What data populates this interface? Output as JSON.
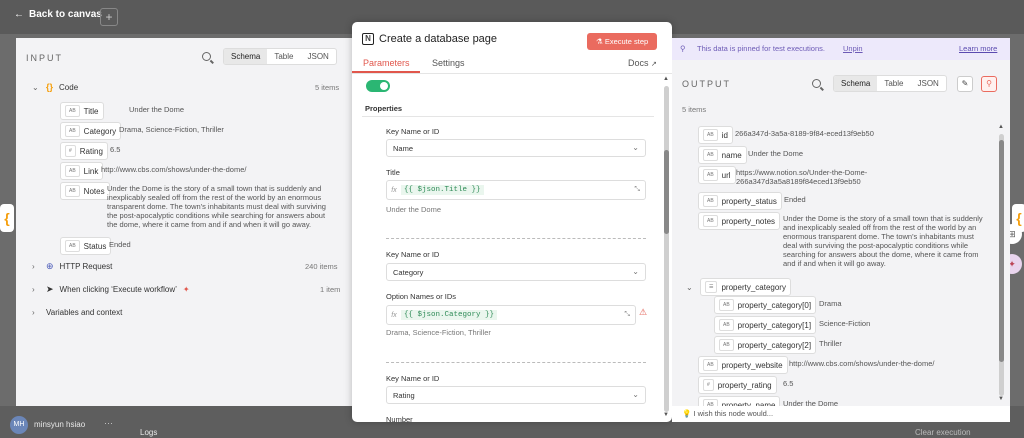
{
  "canvas": {
    "back_label": "Back to canvas",
    "user_initials": "MH",
    "user_name": "minsyun hsiao",
    "logs_label": "Logs",
    "clear_execution": "Clear execution",
    "more_icon": "dots-icon",
    "add_icon": "plus-icon"
  },
  "input": {
    "title": "INPUT",
    "view_tabs": [
      "Schema",
      "Table",
      "JSON"
    ],
    "active_view": "Schema",
    "code_node": {
      "label": "Code",
      "count": "5 items",
      "fields": [
        {
          "type": "AB",
          "key": "Title",
          "value": "Under the Dome"
        },
        {
          "type": "AB",
          "key": "Category",
          "value": "Drama, Science-Fiction, Thriller"
        },
        {
          "type": "#",
          "key": "Rating",
          "value": "6.5"
        },
        {
          "type": "AB",
          "key": "Link",
          "value": "http://www.cbs.com/shows/under-the-dome/"
        },
        {
          "type": "AB",
          "key": "Notes",
          "value": "Under the Dome is the story of a small town that is suddenly and inexplicably sealed off from the rest of the world by an enormous transparent dome. The town's inhabitants must deal with surviving the post-apocalyptic conditions while searching for answers about the dome, where it came from and if and when it will go away."
        },
        {
          "type": "AB",
          "key": "Status",
          "value": "Ended"
        }
      ]
    },
    "http_node": {
      "label": "HTTP Request",
      "count": "240 items"
    },
    "trigger_node": {
      "label": "When clicking ‘Execute workflow’",
      "count": "1 item"
    },
    "variables_label": "Variables and context"
  },
  "center": {
    "node_title": "Create a database page",
    "execute_label": "Execute step",
    "tabs": [
      "Parameters",
      "Settings"
    ],
    "docs_label": "Docs",
    "properties_label": "Properties",
    "groups": [
      {
        "key_label": "Key Name or ID",
        "key_value": "Name",
        "value_label": "Title",
        "expression": "{{ $json.Title }}",
        "preview": "Under the Dome"
      },
      {
        "key_label": "Key Name or ID",
        "key_value": "Category",
        "value_label": "Option Names or IDs",
        "expression": "{{ $json.Category }}",
        "preview": "Drama, Science-Fiction, Thriller"
      },
      {
        "key_label": "Key Name or ID",
        "key_value": "Rating",
        "value_label": "Number"
      }
    ]
  },
  "output": {
    "pinned_text": "This data is pinned for test executions.",
    "unpin_label": "Unpin",
    "learn_more": "Learn more",
    "title": "OUTPUT",
    "view_tabs": [
      "Schema",
      "Table",
      "JSON"
    ],
    "active_view": "Schema",
    "count": "5 items",
    "fields": [
      {
        "type": "AB",
        "key": "id",
        "value": "266a347d-3a5a-8189-9f84-eced13f9eb50"
      },
      {
        "type": "AB",
        "key": "name",
        "value": "Under the Dome"
      },
      {
        "type": "AB",
        "key": "url",
        "value": "https://www.notion.so/Under-the-Dome-266a347d3a5a8189f84eced13f9eb50"
      },
      {
        "type": "AB",
        "key": "property_status",
        "value": "Ended"
      },
      {
        "type": "AB",
        "key": "property_notes",
        "value": "Under the Dome is the story of a small town that is suddenly and inexplicably sealed off from the rest of the world by an enormous transparent dome. The town's inhabitants must deal with surviving the post-apocalyptic conditions while searching for answers about the dome, where it came from and if and when it will go away."
      }
    ],
    "category_key": "property_category",
    "category_items": [
      {
        "type": "AB",
        "key": "property_category[0]",
        "value": "Drama"
      },
      {
        "type": "AB",
        "key": "property_category[1]",
        "value": "Science-Fiction"
      },
      {
        "type": "AB",
        "key": "property_category[2]",
        "value": "Thriller"
      }
    ],
    "more_fields": [
      {
        "type": "AB",
        "key": "property_website",
        "value": "http://www.cbs.com/shows/under-the-dome/"
      },
      {
        "type": "#",
        "key": "property_rating",
        "value": "6.5"
      },
      {
        "type": "AB",
        "key": "property_name",
        "value": "Under the Dome"
      }
    ],
    "feedback": "I wish this node would..."
  }
}
